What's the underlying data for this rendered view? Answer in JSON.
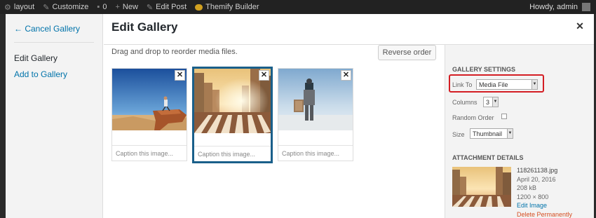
{
  "admin_bar": {
    "items": [
      {
        "icon": "wordpress-icon",
        "label": "layout"
      },
      {
        "icon": "brush-icon",
        "label": "Customize"
      },
      {
        "icon": "comment-icon",
        "label": "0"
      },
      {
        "icon": "plus-icon",
        "label": "New"
      },
      {
        "icon": "pencil-icon",
        "label": "Edit Post"
      },
      {
        "icon": "builder-icon",
        "label": "Themify Builder"
      }
    ],
    "greeting": "Howdy, admin"
  },
  "menu": {
    "cancel": "← Cancel Gallery",
    "items": [
      {
        "label": "Edit Gallery",
        "active": true
      },
      {
        "label": "Add to Gallery",
        "active": false
      }
    ]
  },
  "title": "Edit Gallery",
  "instructions": "Drag and drop to reorder media files.",
  "reverse_order": "Reverse order",
  "attachments": [
    {
      "caption_placeholder": "Caption this image...",
      "selected": false,
      "image": "desert rock climber"
    },
    {
      "caption_placeholder": "Caption this image...",
      "selected": true,
      "image": "city crosswalk sunset"
    },
    {
      "caption_placeholder": "Caption this image...",
      "selected": false,
      "image": "businessman with suitcase"
    }
  ],
  "gallery_settings": {
    "heading": "Gallery Settings",
    "link_to_label": "Link To",
    "link_to_value": "Media File",
    "columns_label": "Columns",
    "columns_value": "3",
    "random_order_label": "Random Order",
    "size_label": "Size",
    "size_value": "Thumbnail"
  },
  "attachment_details": {
    "heading": "Attachment Details",
    "filename": "118261138.jpg",
    "date": "April 20, 2016",
    "filesize": "208 kB",
    "dimensions": "1200 × 800",
    "edit_link": "Edit Image",
    "delete_link": "Delete Permanently"
  },
  "colors": {
    "highlight": "#d41e24",
    "selected_border": "#1a5f8a",
    "link": "#0073aa",
    "delete": "#d54e21"
  }
}
